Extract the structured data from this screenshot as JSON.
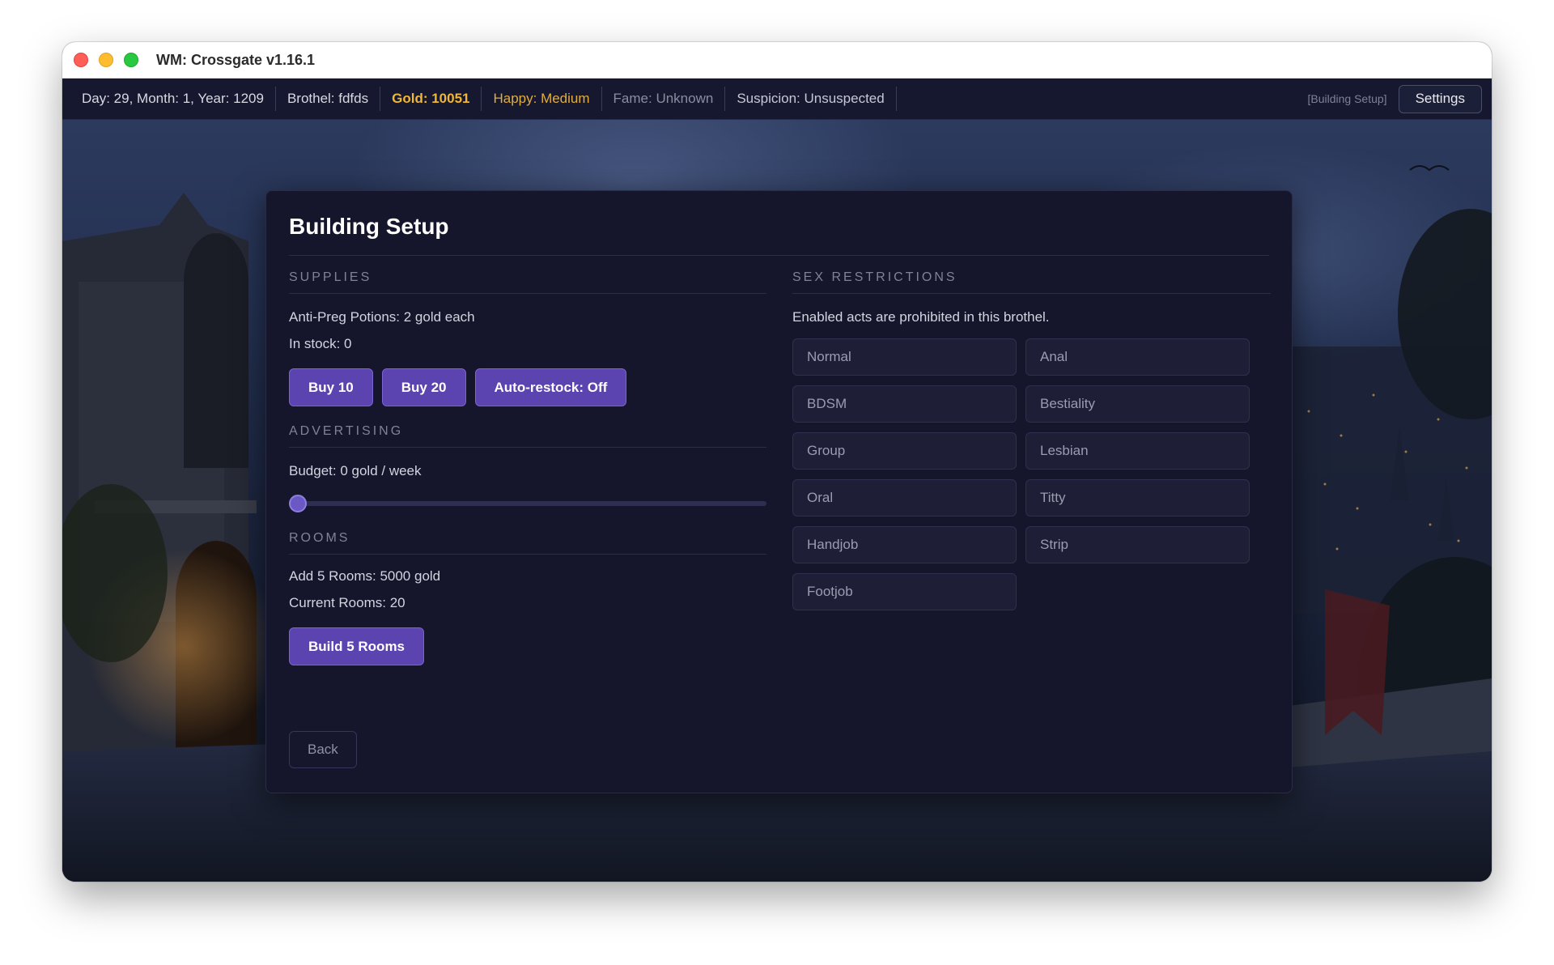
{
  "window": {
    "title": "WM: Crossgate v1.16.1"
  },
  "status": {
    "date": "Day: 29, Month: 1, Year: 1209",
    "brothel": "Brothel: fdfds",
    "gold": "Gold: 10051",
    "happy": "Happy: Medium",
    "fame": "Fame: Unknown",
    "suspicion": "Suspicion: Unsuspected",
    "screen_tag": "[Building Setup]",
    "settings_label": "Settings"
  },
  "colors": {
    "gold": "#f2b632",
    "happy": "#e2ad3f",
    "accent": "#5b43b0",
    "panel": "#15152b"
  },
  "panel": {
    "title": "Building Setup",
    "back_label": "Back"
  },
  "supplies": {
    "label": "SUPPLIES",
    "price_line": "Anti-Preg Potions: 2 gold each",
    "stock_line": "In stock: 0",
    "buttons": [
      "Buy 10",
      "Buy 20",
      "Auto-restock: Off"
    ]
  },
  "advertising": {
    "label": "ADVERTISING",
    "budget_line": "Budget: 0 gold / week",
    "slider_fraction": 0
  },
  "rooms": {
    "label": "ROOMS",
    "cost_line": "Add 5 Rooms: 5000 gold",
    "current_line": "Current Rooms: 20",
    "build_label": "Build 5 Rooms"
  },
  "restrictions": {
    "label": "SEX RESTRICTIONS",
    "description": "Enabled acts are prohibited in this brothel.",
    "acts": [
      "Normal",
      "Anal",
      "BDSM",
      "Bestiality",
      "Group",
      "Lesbian",
      "Oral",
      "Titty",
      "Handjob",
      "Strip",
      "Footjob"
    ]
  }
}
